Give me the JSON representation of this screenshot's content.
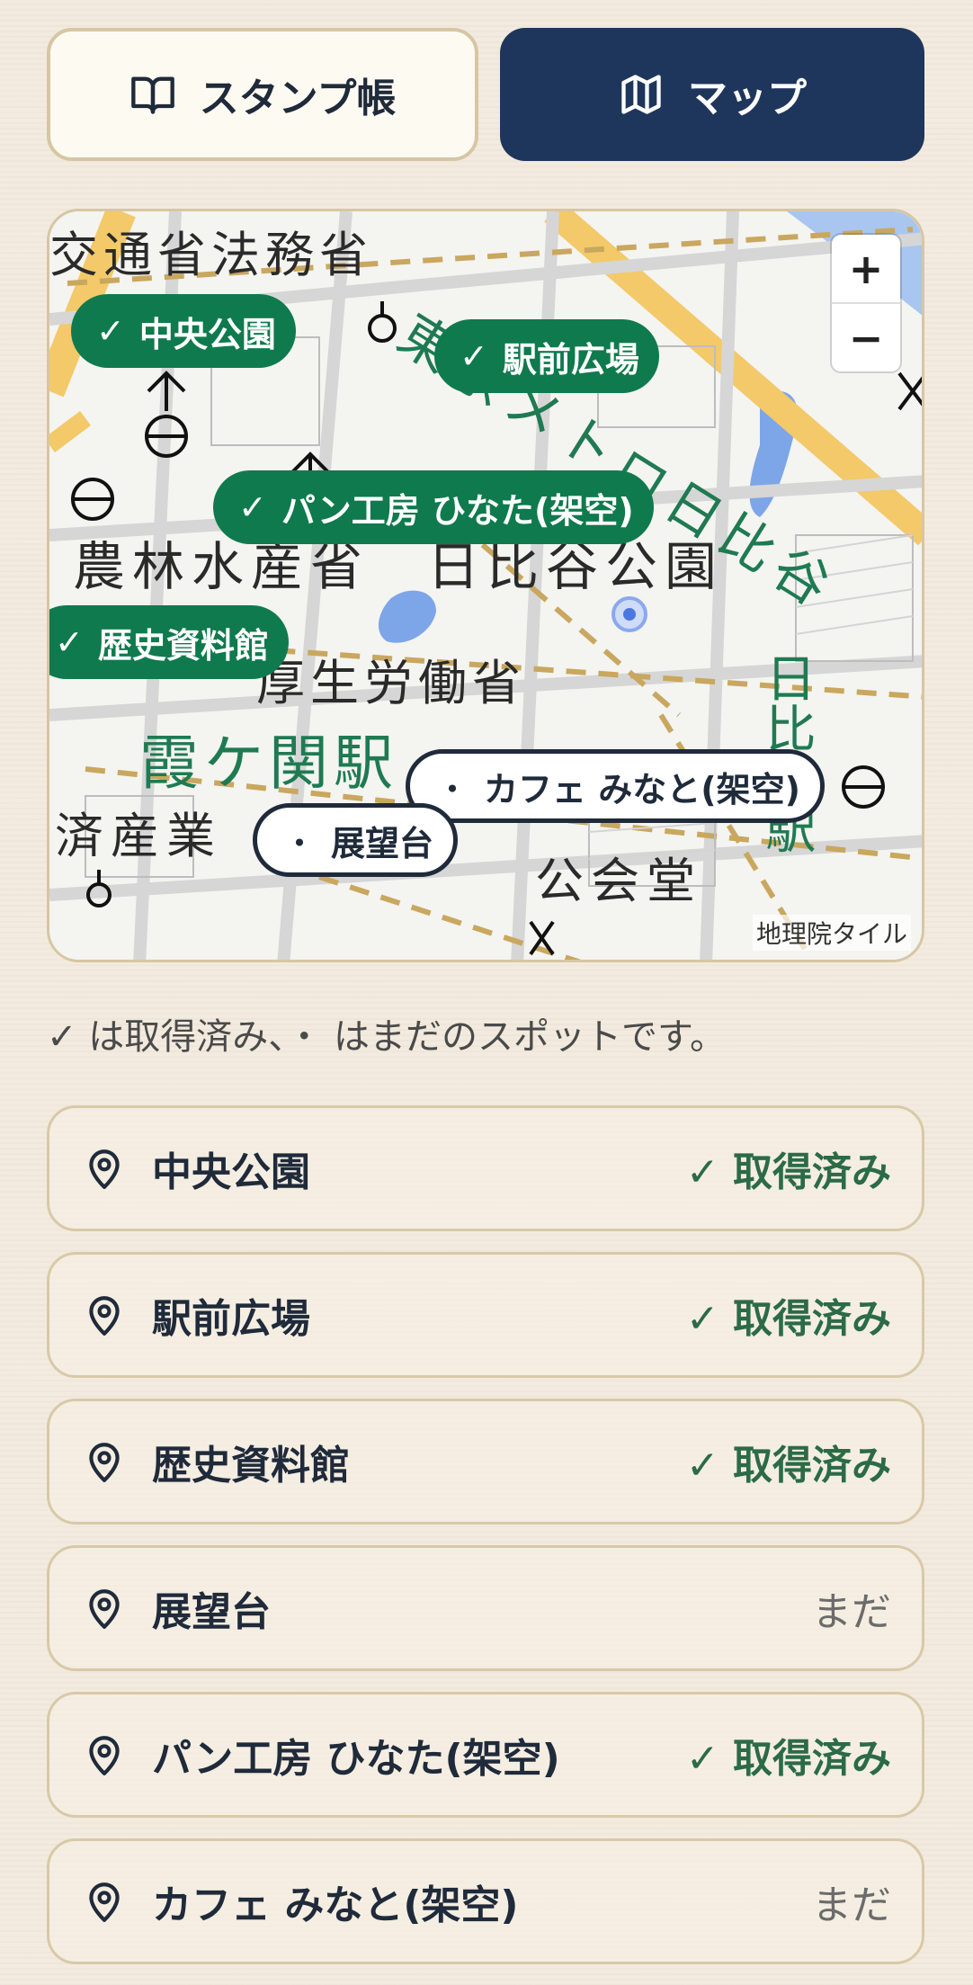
{
  "tabs": [
    {
      "label": "スタンプ帳",
      "icon": "book-open-icon",
      "active": false
    },
    {
      "label": "マップ",
      "icon": "map-icon",
      "active": true
    }
  ],
  "map": {
    "zoom_in": "+",
    "zoom_out": "−",
    "attribution": "地理院タイル",
    "place_labels": [
      "交通省法務省",
      "農林水産省",
      "日比谷公園",
      "厚生労働省",
      "霞ケ関駅",
      "済産業",
      "公会堂",
      "日比谷駅",
      "東京メトロ日比谷"
    ],
    "pins": [
      {
        "label": "中央公園",
        "mark": "✓",
        "status": "done"
      },
      {
        "label": "駅前広場",
        "mark": "✓",
        "status": "done"
      },
      {
        "label": "パン工房 ひなた(架空)",
        "mark": "✓",
        "status": "done"
      },
      {
        "label": "歴史資料館",
        "mark": "✓",
        "status": "done"
      },
      {
        "label": "カフェ みなと(架空)",
        "mark": "・",
        "status": "todo"
      },
      {
        "label": "展望台",
        "mark": "・",
        "status": "todo"
      }
    ]
  },
  "legend": "✓ は取得済み、・ はまだのスポットです。",
  "spots": [
    {
      "name": "中央公園",
      "status": "✓ 取得済み",
      "done": true
    },
    {
      "name": "駅前広場",
      "status": "✓ 取得済み",
      "done": true
    },
    {
      "name": "歴史資料館",
      "status": "✓ 取得済み",
      "done": true
    },
    {
      "name": "展望台",
      "status": "まだ",
      "done": false
    },
    {
      "name": "パン工房 ひなた(架空)",
      "status": "✓ 取得済み",
      "done": true
    },
    {
      "name": "カフェ みなと(架空)",
      "status": "まだ",
      "done": false
    }
  ],
  "colors": {
    "accent_navy": "#1f365c",
    "done_green": "#0f7a4d",
    "status_green": "#2b6b45",
    "background": "#f3ebdf"
  }
}
